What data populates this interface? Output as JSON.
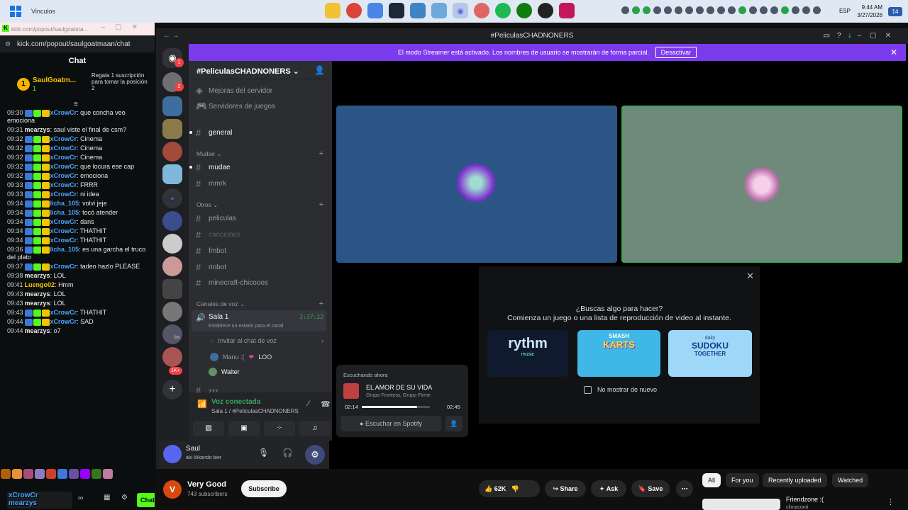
{
  "taskbar": {
    "title": "Vinculos",
    "lang": "ESP",
    "time": "9:44 AM",
    "date": "3/27/2026",
    "notifications": "14"
  },
  "kick": {
    "tab_title": "kick.com/popout/saulgoatma...",
    "url": "kick.com/popout/saulgoatmaan/chat",
    "chat_header": "Chat",
    "pinned_user": "SaulGoatm...",
    "pinned_count": "1",
    "gift_text": "Regala 1 suscripción para tomar la posición 2",
    "messages": [
      {
        "time": "09:30",
        "user": "xCrowCr",
        "text": "que concha veo emociona",
        "color": "#4aa3ff",
        "badges": true
      },
      {
        "time": "09:31",
        "user": "mearzys",
        "text": "saul viste el final de csm?",
        "color": "#e8e8e8",
        "badges": false
      },
      {
        "time": "09:32",
        "user": "xCrowCr",
        "text": "Cinema",
        "color": "#4aa3ff",
        "badges": true
      },
      {
        "time": "09:32",
        "user": "xCrowCr",
        "text": "Cinema",
        "color": "#4aa3ff",
        "badges": true
      },
      {
        "time": "09:32",
        "user": "xCrowCr",
        "text": "Cinema",
        "color": "#4aa3ff",
        "badges": true
      },
      {
        "time": "09:32",
        "user": "xCrowCr",
        "text": "que locura ese cap",
        "color": "#4aa3ff",
        "badges": true
      },
      {
        "time": "09:32",
        "user": "xCrowCr",
        "text": "emociona",
        "color": "#4aa3ff",
        "badges": true
      },
      {
        "time": "09:33",
        "user": "xCrowCr",
        "text": "FRRR",
        "color": "#4aa3ff",
        "badges": true
      },
      {
        "time": "09:33",
        "user": "xCrowCr",
        "text": "ni idea",
        "color": "#4aa3ff",
        "badges": true
      },
      {
        "time": "09:34",
        "user": "licha_105",
        "text": "volvi jeje",
        "color": "#4aa3ff",
        "badges": true
      },
      {
        "time": "09:34",
        "user": "licha_105",
        "text": "tocó atender",
        "color": "#4aa3ff",
        "badges": true
      },
      {
        "time": "09:34",
        "user": "xCrowCr",
        "text": "dans",
        "color": "#4aa3ff",
        "badges": true
      },
      {
        "time": "09:34",
        "user": "xCrowCr",
        "text": "THATHIT",
        "color": "#4aa3ff",
        "badges": true
      },
      {
        "time": "09:34",
        "user": "xCrowCr",
        "text": "THATHIT",
        "color": "#4aa3ff",
        "badges": true
      },
      {
        "time": "09:36",
        "user": "licha_105",
        "text": "es una garcha el truco del plato",
        "color": "#4aa3ff",
        "badges": true
      },
      {
        "time": "09:37",
        "user": "xCrowCr",
        "text": "tadeo hazlo PLEASE",
        "color": "#4aa3ff",
        "badges": true
      },
      {
        "time": "09:38",
        "user": "mearzys",
        "text": "LOL",
        "color": "#e8e8e8",
        "badges": false
      },
      {
        "time": "09:41",
        "user": "Luengo02",
        "text": "Hmm",
        "color": "#f5c400",
        "badges": false
      },
      {
        "time": "09:43",
        "user": "mearzys",
        "text": "LOL",
        "color": "#e8e8e8",
        "badges": false
      },
      {
        "time": "09:43",
        "user": "mearzys",
        "text": "LOL",
        "color": "#e8e8e8",
        "badges": false
      },
      {
        "time": "09:43",
        "user": "xCrowCr",
        "text": "THATHIT",
        "color": "#4aa3ff",
        "badges": true
      },
      {
        "time": "09:44",
        "user": "xCrowCr",
        "text": "SAD",
        "color": "#4aa3ff",
        "badges": true
      },
      {
        "time": "09:44",
        "user": "mearzys",
        "text": "o7",
        "color": "#e8e8e8",
        "badges": false
      }
    ],
    "overlay_users": "xCrowCr\nmearzys",
    "chat_button": "Chat"
  },
  "discord": {
    "window_title": "#PeliculasCHADNONERS",
    "banner_text": "El modo Streamer está activado. Los nombres de usuario se mostrarán de forma parcial.",
    "banner_button": "Desactivar",
    "server_name": "#PeliculasCHADNONERS",
    "menu1": "Mejoras del servidor",
    "menu2": "Servidores de juegos",
    "general": "general",
    "cat_mudae": "Mudae",
    "mudae": "mudae",
    "mmrk": "mmrk",
    "cat_otros": "Otros",
    "peliculas": "peliculas",
    "canciones": "canciones",
    "fmbot": "fmbot",
    "rinbot": "rinbot",
    "minecraft": "minecraft-chicooos",
    "cat_voz": "Canales de voz",
    "sala": "Sala 1",
    "sala_time": "2:37:22",
    "sala_status": "Establece un estado para el canal",
    "invite": "Invitar al chat de voz",
    "member1": "Manu :(",
    "member1_tag": "ᒪOO",
    "member2": "Walter",
    "zzz": "zzz",
    "voice_status": "Voz conectada",
    "voice_channel": "Sala 1 / #PeliculasCHADNONERS",
    "user_name": "Saul",
    "user_status": "aki klikando bier",
    "unread_badge": "1",
    "unread_badge2": "2",
    "member_badge": "1K+",
    "bs": "bs",
    "activity_q": "¿Buscas algo para hacer?",
    "activity_sub": "Comienza un juego o una lista de reproducción de video al instante.",
    "dont_show": "No mostrar de nuevo",
    "game1": "rythm",
    "game1_sub": "music",
    "game2_line1": "SMASH",
    "game2_line2": "KARTS",
    "game3_line1": "daily",
    "game3_line2": "SUDOKU",
    "game3_line3": "TOGETHER",
    "np_label": "Escuchando ahora",
    "np_song": "EL AMOR DE SU VIDA",
    "np_artist": "Grupo Frontera, Grupo Firme",
    "np_elapsed": "02:14",
    "np_total": "02:45",
    "np_progress": 0.81,
    "np_button": "Escuchar en Spotify"
  },
  "youtube": {
    "channel": "Very Good",
    "subs": "743 subscribers",
    "subscribe": "Subscribe",
    "likes": "62K",
    "share": "Share",
    "ask": "Ask",
    "save": "Save",
    "chips": [
      "All",
      "For you",
      "Recently uploaded",
      "Watched"
    ],
    "rec_title": "Friendzone :(",
    "rec_sub": "climaconti"
  }
}
